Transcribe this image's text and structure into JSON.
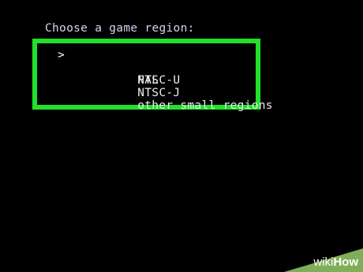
{
  "prompt": "Choose a game region:",
  "cursor": ">",
  "menu": {
    "selected_index": 0,
    "items": [
      {
        "label": "NTSC-U"
      },
      {
        "label": "PAL"
      },
      {
        "label": "NTSC-J"
      },
      {
        "label": "other small regions"
      }
    ]
  },
  "watermark": {
    "part1": "wiki",
    "part2": "How"
  },
  "colors": {
    "background": "#000000",
    "text": "#d9d2f0",
    "highlight_border": "#22e02b",
    "watermark_bg": "#7fae5a"
  }
}
